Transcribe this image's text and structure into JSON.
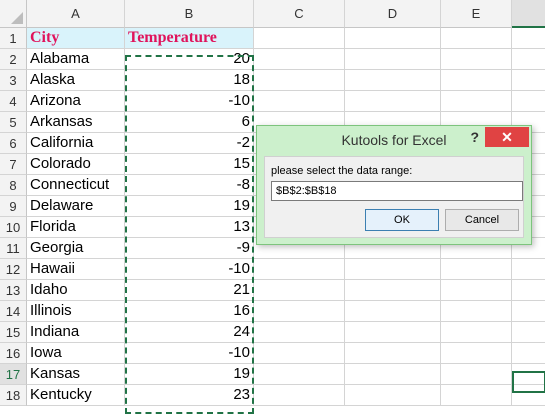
{
  "columns": [
    "A",
    "B",
    "C",
    "D",
    "E"
  ],
  "rows": [
    "1",
    "2",
    "3",
    "4",
    "5",
    "6",
    "7",
    "8",
    "9",
    "10",
    "11",
    "12",
    "13",
    "14",
    "15",
    "16",
    "17",
    "18"
  ],
  "table": {
    "header": {
      "city": "City",
      "temperature": "Temperature"
    },
    "data": [
      {
        "city": "Alabama",
        "temp": "20"
      },
      {
        "city": "Alaska",
        "temp": "18"
      },
      {
        "city": "Arizona",
        "temp": "-10"
      },
      {
        "city": "Arkansas",
        "temp": "6"
      },
      {
        "city": "California",
        "temp": "-2"
      },
      {
        "city": "Colorado",
        "temp": "15"
      },
      {
        "city": "Connecticut",
        "temp": "-8"
      },
      {
        "city": "Delaware",
        "temp": "19"
      },
      {
        "city": "Florida",
        "temp": "13"
      },
      {
        "city": "Georgia",
        "temp": "-9"
      },
      {
        "city": "Hawaii",
        "temp": "-10"
      },
      {
        "city": "Idaho",
        "temp": "21"
      },
      {
        "city": "Illinois",
        "temp": "16"
      },
      {
        "city": "Indiana",
        "temp": "24"
      },
      {
        "city": "Iowa",
        "temp": "-10"
      },
      {
        "city": "Kansas",
        "temp": "19"
      },
      {
        "city": "Kentucky",
        "temp": "23"
      }
    ]
  },
  "dialog": {
    "title": "Kutools for Excel",
    "help": "?",
    "close": "✕",
    "prompt": "please select the data range:",
    "range_value": "$B$2:$B$18",
    "ok_label": "OK",
    "cancel_label": "Cancel"
  },
  "colors": {
    "header_fill": "#d9f3fb",
    "header_text": "#e0135b",
    "selection_green": "#217346",
    "dialog_bg": "#ccf0cc",
    "close_red": "#e04343"
  }
}
